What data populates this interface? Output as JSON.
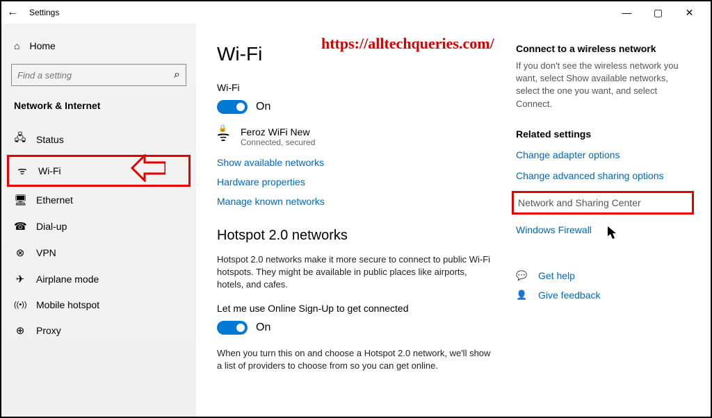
{
  "window": {
    "title": "Settings",
    "back_icon": "←"
  },
  "sidebar": {
    "home_label": "Home",
    "search_placeholder": "Find a setting",
    "category": "Network & Internet",
    "items": [
      {
        "icon": "🖧",
        "label": "Status"
      },
      {
        "icon": "ᯤ",
        "label": "Wi-Fi"
      },
      {
        "icon": "🖥",
        "label": "Ethernet"
      },
      {
        "icon": "☎",
        "label": "Dial-up"
      },
      {
        "icon": "⊗",
        "label": "VPN"
      },
      {
        "icon": "✈",
        "label": "Airplane mode"
      },
      {
        "icon": "((•))",
        "label": "Mobile hotspot"
      },
      {
        "icon": "⊕",
        "label": "Proxy"
      }
    ]
  },
  "main": {
    "heading": "Wi-Fi",
    "wifi_label": "Wi-Fi",
    "wifi_toggle_state": "On",
    "network": {
      "name": "Feroz WiFi New",
      "status": "Connected, secured"
    },
    "links": {
      "show_networks": "Show available networks",
      "hardware": "Hardware properties",
      "manage_known": "Manage known networks"
    },
    "hotspot": {
      "heading": "Hotspot 2.0 networks",
      "desc": "Hotspot 2.0 networks make it more secure to connect to public Wi-Fi hotspots. They might be available in public places like airports, hotels, and cafes.",
      "signup_label": "Let me use Online Sign-Up to get connected",
      "toggle_state": "On",
      "info": "When you turn this on and choose a Hotspot 2.0 network, we'll show a list of providers to choose from so you can get online."
    }
  },
  "right": {
    "connect_head": "Connect to a wireless network",
    "connect_desc": "If you don't see the wireless network you want, select Show available networks, select the one you want, and select Connect.",
    "related_head": "Related settings",
    "adapter": "Change adapter options",
    "advshare": "Change advanced sharing options",
    "sharecenter": "Network and Sharing Center",
    "firewall": "Windows Firewall",
    "gethelp": "Get help",
    "feedback": "Give feedback"
  },
  "annotations": {
    "watermark": "https://alltechqueries.com/"
  }
}
